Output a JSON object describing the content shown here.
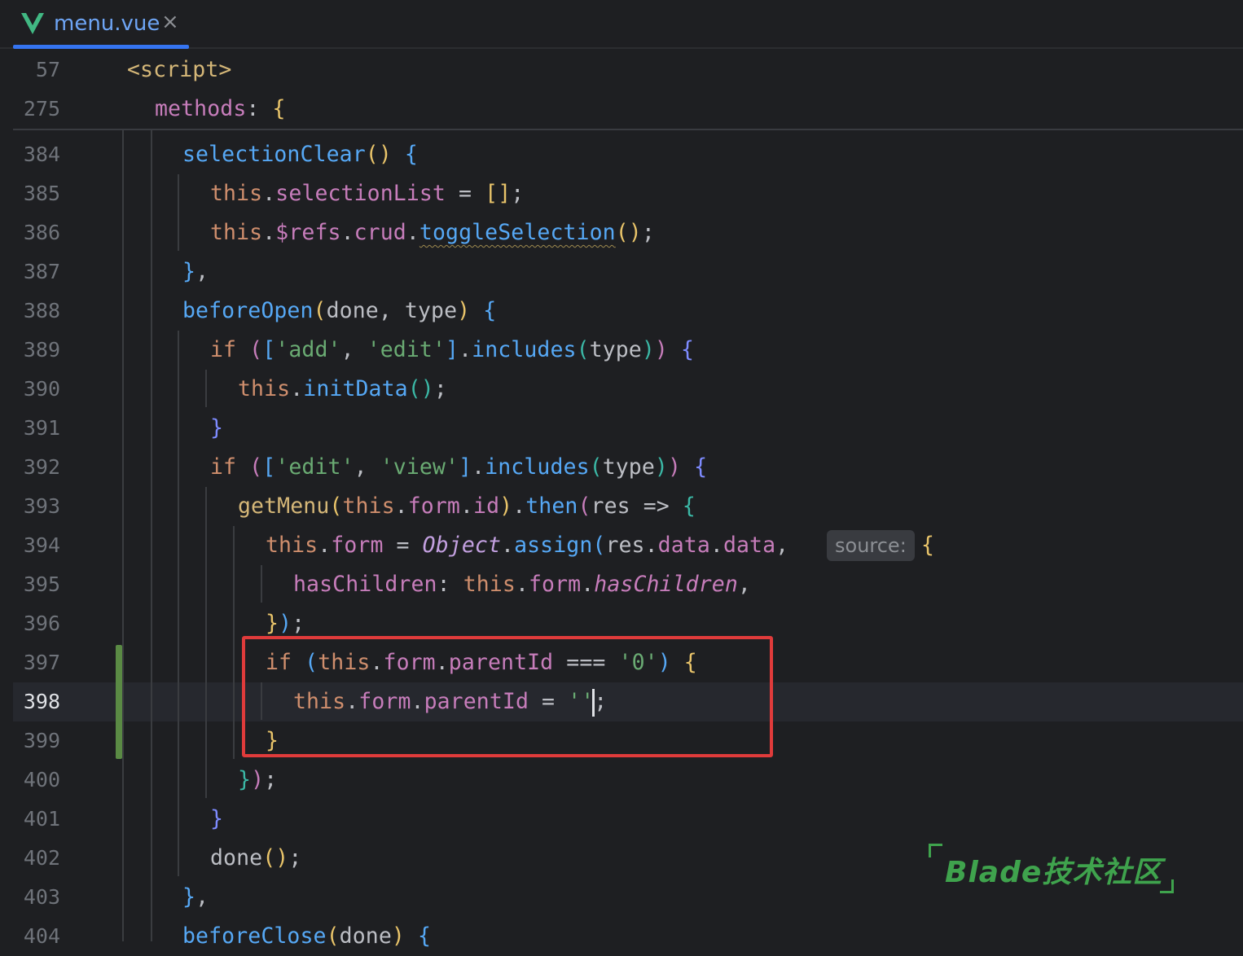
{
  "tab": {
    "title": "menu.vue",
    "close": "×",
    "icon": "vue-icon"
  },
  "sticky_lines": [
    {
      "num": "57",
      "tokens": [
        [
          "t",
          "<script>"
        ]
      ]
    },
    {
      "num": "275",
      "tokens": [
        [
          "p",
          "methods"
        ],
        [
          "",
          "?: "
        ],
        [
          "b1",
          "{"
        ]
      ]
    }
  ],
  "lines": [
    {
      "num": "384",
      "tokens": [
        [
          "fn",
          "selectionClear"
        ],
        [
          "b1",
          "()"
        ],
        [
          "",
          ""
        ],
        [
          "b3",
          " {"
        ]
      ]
    },
    {
      "num": "385",
      "tokens": [
        [
          "k",
          "this"
        ],
        [
          "",
          "."
        ],
        [
          "p",
          "selectionList"
        ],
        [
          "",
          " = "
        ],
        [
          "b1",
          "[]"
        ],
        [
          "",
          ";"
        ]
      ]
    },
    {
      "num": "386",
      "tokens": [
        [
          "k",
          "this"
        ],
        [
          "",
          "."
        ],
        [
          "p",
          "$refs"
        ],
        [
          "",
          "."
        ],
        [
          "p",
          "crud"
        ],
        [
          "",
          "."
        ],
        [
          "sq",
          "toggleSelection"
        ],
        [
          "b1",
          "()"
        ],
        [
          "",
          ";"
        ]
      ]
    },
    {
      "num": "387",
      "tokens": [
        [
          "b3",
          "}"
        ],
        [
          "",
          ","
        ]
      ]
    },
    {
      "num": "388",
      "tokens": [
        [
          "fn",
          "beforeOpen"
        ],
        [
          "b1",
          "("
        ],
        [
          "",
          "done, type"
        ],
        [
          "b1",
          ")"
        ],
        [
          "b3",
          " {"
        ]
      ]
    },
    {
      "num": "389",
      "tokens": [
        [
          "k",
          "if "
        ],
        [
          "b2",
          "("
        ],
        [
          "b3",
          "["
        ],
        [
          "s",
          "'add'"
        ],
        [
          "",
          ", "
        ],
        [
          "s",
          "'edit'"
        ],
        [
          "b3",
          "]"
        ],
        [
          "",
          "."
        ],
        [
          "fn",
          "includes"
        ],
        [
          "b4",
          "("
        ],
        [
          "",
          "type"
        ],
        [
          "b4",
          ")"
        ],
        [
          "b2",
          ")"
        ],
        [
          "b5",
          " {"
        ]
      ]
    },
    {
      "num": "390",
      "tokens": [
        [
          "k",
          "this"
        ],
        [
          "",
          "."
        ],
        [
          "fn",
          "initData"
        ],
        [
          "b4",
          "()"
        ],
        [
          "",
          ";"
        ]
      ]
    },
    {
      "num": "391",
      "tokens": [
        [
          "b5",
          "}"
        ]
      ]
    },
    {
      "num": "392",
      "tokens": [
        [
          "k",
          "if "
        ],
        [
          "b2",
          "("
        ],
        [
          "b3",
          "["
        ],
        [
          "s",
          "'edit'"
        ],
        [
          "",
          ", "
        ],
        [
          "s",
          "'view'"
        ],
        [
          "b3",
          "]"
        ],
        [
          "",
          "."
        ],
        [
          "fn",
          "includes"
        ],
        [
          "b4",
          "("
        ],
        [
          "",
          "type"
        ],
        [
          "b4",
          ")"
        ],
        [
          "b2",
          ")"
        ],
        [
          "b5",
          " {"
        ]
      ]
    },
    {
      "num": "393",
      "tokens": [
        [
          "t",
          "getMenu"
        ],
        [
          "b1",
          "("
        ],
        [
          "k",
          "this"
        ],
        [
          "",
          "."
        ],
        [
          "p",
          "form"
        ],
        [
          "",
          "."
        ],
        [
          "p",
          "id"
        ],
        [
          "b1",
          ")"
        ],
        [
          "",
          "."
        ],
        [
          "fn",
          "then"
        ],
        [
          "b2",
          "("
        ],
        [
          "",
          "res => "
        ],
        [
          "b4",
          "{"
        ]
      ]
    },
    {
      "num": "394",
      "tokens": [
        [
          "k",
          "this"
        ],
        [
          "",
          "."
        ],
        [
          "p",
          "form"
        ],
        [
          "",
          " = "
        ],
        [
          "o",
          "Object"
        ],
        [
          "",
          "."
        ],
        [
          "fn",
          "assign"
        ],
        [
          "b3",
          "("
        ],
        [
          "",
          "res."
        ],
        [
          "p",
          "data"
        ],
        [
          "",
          "."
        ],
        [
          "p",
          "data"
        ],
        [
          "",
          ",  "
        ]
      ]
    },
    {
      "num": "395",
      "tokens": [
        [
          "p",
          "hasChildren"
        ],
        [
          "",
          ": "
        ],
        [
          "k",
          "this"
        ],
        [
          "",
          "."
        ],
        [
          "p",
          "form"
        ],
        [
          "",
          "."
        ],
        [
          "i",
          "hasChildren"
        ],
        [
          "",
          ","
        ]
      ]
    },
    {
      "num": "396",
      "tokens": [
        [
          "b1",
          "}"
        ],
        [
          "b3",
          ")"
        ],
        [
          "",
          ";"
        ]
      ]
    },
    {
      "num": "397",
      "tokens": [
        [
          "k",
          "if "
        ],
        [
          "b3",
          "("
        ],
        [
          "k",
          "this"
        ],
        [
          "",
          "."
        ],
        [
          "p",
          "form"
        ],
        [
          "",
          "."
        ],
        [
          "p",
          "parentId"
        ],
        [
          "",
          " === "
        ],
        [
          "s",
          "'0'"
        ],
        [
          "b3",
          ")"
        ],
        [
          "b1",
          " {"
        ]
      ]
    },
    {
      "num": "398",
      "tokens": [
        [
          "k",
          "this"
        ],
        [
          "",
          "."
        ],
        [
          "p",
          "form"
        ],
        [
          "",
          "."
        ],
        [
          "p",
          "parentId"
        ],
        [
          "",
          " = "
        ],
        [
          "s",
          "''"
        ],
        [
          "",
          ";"
        ]
      ]
    },
    {
      "num": "399",
      "tokens": [
        [
          "b1",
          "}"
        ]
      ]
    },
    {
      "num": "400",
      "tokens": [
        [
          "b4",
          "}"
        ],
        [
          "b2",
          ")"
        ],
        [
          "",
          ";"
        ]
      ]
    },
    {
      "num": "401",
      "tokens": [
        [
          "b5",
          "}"
        ]
      ]
    },
    {
      "num": "402",
      "tokens": [
        [
          "",
          "done"
        ],
        [
          "b1",
          "()"
        ],
        [
          "",
          ";"
        ]
      ]
    },
    {
      "num": "403",
      "tokens": [
        [
          "b3",
          "}"
        ],
        [
          "",
          ","
        ]
      ]
    },
    {
      "num": "404",
      "tokens": [
        [
          "fn",
          "beforeClose"
        ],
        [
          "b1",
          "("
        ],
        [
          "",
          "done"
        ],
        [
          "b1",
          ")"
        ],
        [
          "b3",
          " {"
        ]
      ]
    }
  ],
  "inlay_hint": {
    "label": "source:",
    "after": "{"
  },
  "watermark": "Blade技术社区"
}
